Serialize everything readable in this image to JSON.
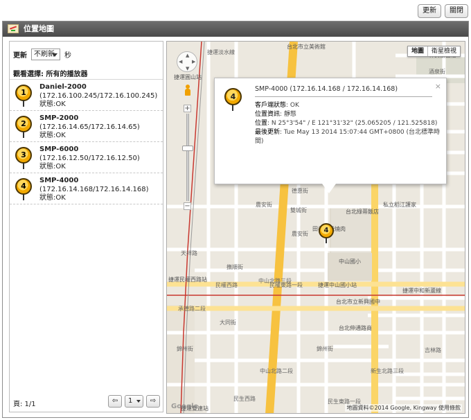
{
  "toolbar": {
    "refresh_label": "更新",
    "close_label": "關閉"
  },
  "panel": {
    "title": "位置地圖"
  },
  "left": {
    "refresh_label": "更新",
    "refresh_value": "不刷新",
    "refresh_unit": "秒",
    "watch_label": "觀看選擇: 所有的播放器",
    "players": [
      {
        "num": "1",
        "name": "Daniel-2000",
        "ip": "(172.16.100.245/172.16.100.245)",
        "status": "狀態:OK"
      },
      {
        "num": "2",
        "name": "SMP-2000",
        "ip": "(172.16.14.65/172.16.14.65)",
        "status": "狀態:OK"
      },
      {
        "num": "3",
        "name": "SMP-6000",
        "ip": "(172.16.12.50/172.16.12.50)",
        "status": "狀態:OK"
      },
      {
        "num": "4",
        "name": "SMP-4000",
        "ip": "(172.16.14.168/172.16.14.168)",
        "status": "狀態:OK"
      }
    ],
    "pager": {
      "text": "頁: 1/1",
      "page": "1",
      "prev": "⇦",
      "next": "⇨"
    }
  },
  "map": {
    "type_map": "地圖",
    "type_satellite": "衛星檢視",
    "marker_num": "4",
    "labels": {
      "l1": "台北市立美術館",
      "l2": "中山北路三段",
      "l3": "捷運圓山站",
      "l4": "林安泰古厝",
      "l5": "酒泉街",
      "l6": "玉門街",
      "l7": "農安街",
      "l8": "雙城街",
      "l9": "民權西路",
      "l10": "民權東路一段",
      "l11": "捷運民權西路站",
      "l12": "捷運中山國小站",
      "l13": "中山國小",
      "l14": "錦州街",
      "l15": "民生東路一段",
      "l16": "民生西路",
      "l17": "吉林路",
      "l18": "新生北路三段",
      "l19": "林森北路",
      "l20": "台北市立新興國中",
      "l21": "捷運中和新蘆線",
      "l22": "捷運雙連站",
      "l23": "台北綠蒂飯店",
      "l24": "私立稻江護家",
      "l25": "撫順街",
      "l26": "天祥路",
      "l27": "承德路三段",
      "l28": "大同街",
      "l29": "德惠街",
      "l30": "濱江街",
      "l31": "台北伸通路商",
      "l32": "田季發爺燒肉",
      "l33": "中山北路二段",
      "l34": "捷運淡水線",
      "l35": "民生西路",
      "l36": "承德路二段",
      "l37": "錦西街"
    },
    "attribution": "地圖資料©2014 Google, Kingway   使用條款",
    "google": "Google"
  },
  "info_window": {
    "num": "4",
    "title": "SMP-4000 (172.16.14.168 / 172.16.14.168)",
    "rows": [
      {
        "label": "客戶端狀態",
        "value": ": OK"
      },
      {
        "label": "位置資訊",
        "value": ": 靜態"
      },
      {
        "label": "位置",
        "value": ": N 25°3'54\" / E 121°31'32\" (25.065205 / 121.525818)"
      },
      {
        "label": "最後更新",
        "value": ": Tue May 13 2014 15:07:44 GMT+0800 (台北標準時間)"
      }
    ]
  }
}
